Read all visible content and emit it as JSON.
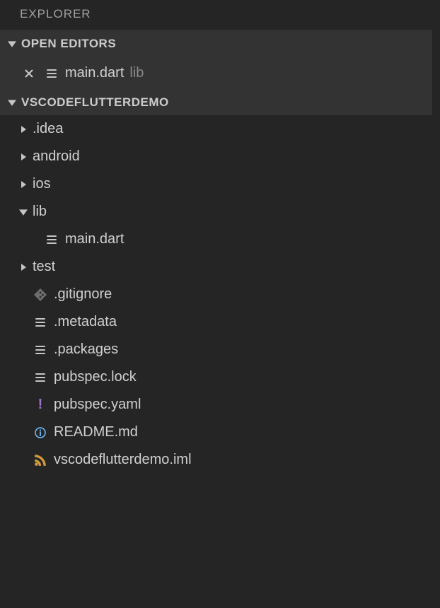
{
  "panel": {
    "title": "EXPLORER"
  },
  "open_editors": {
    "header": "OPEN EDITORS",
    "items": [
      {
        "name": "main.dart",
        "path": "lib"
      }
    ]
  },
  "workspace": {
    "name": "VSCODEFLUTTERDEMO",
    "tree": [
      {
        "type": "folder",
        "expanded": false,
        "name": ".idea"
      },
      {
        "type": "folder",
        "expanded": false,
        "name": "android"
      },
      {
        "type": "folder",
        "expanded": false,
        "name": "ios"
      },
      {
        "type": "folder",
        "expanded": true,
        "name": "lib"
      },
      {
        "type": "file",
        "depth": 1,
        "icon": "lines",
        "name": "main.dart"
      },
      {
        "type": "folder",
        "expanded": false,
        "name": "test"
      },
      {
        "type": "file",
        "icon": "git",
        "name": ".gitignore"
      },
      {
        "type": "file",
        "icon": "lines",
        "name": ".metadata"
      },
      {
        "type": "file",
        "icon": "lines",
        "name": ".packages"
      },
      {
        "type": "file",
        "icon": "lines",
        "name": "pubspec.lock"
      },
      {
        "type": "file",
        "icon": "exclaim",
        "name": "pubspec.yaml"
      },
      {
        "type": "file",
        "icon": "info",
        "name": "README.md"
      },
      {
        "type": "file",
        "icon": "feed",
        "name": "vscodeflutterdemo.iml"
      }
    ]
  }
}
